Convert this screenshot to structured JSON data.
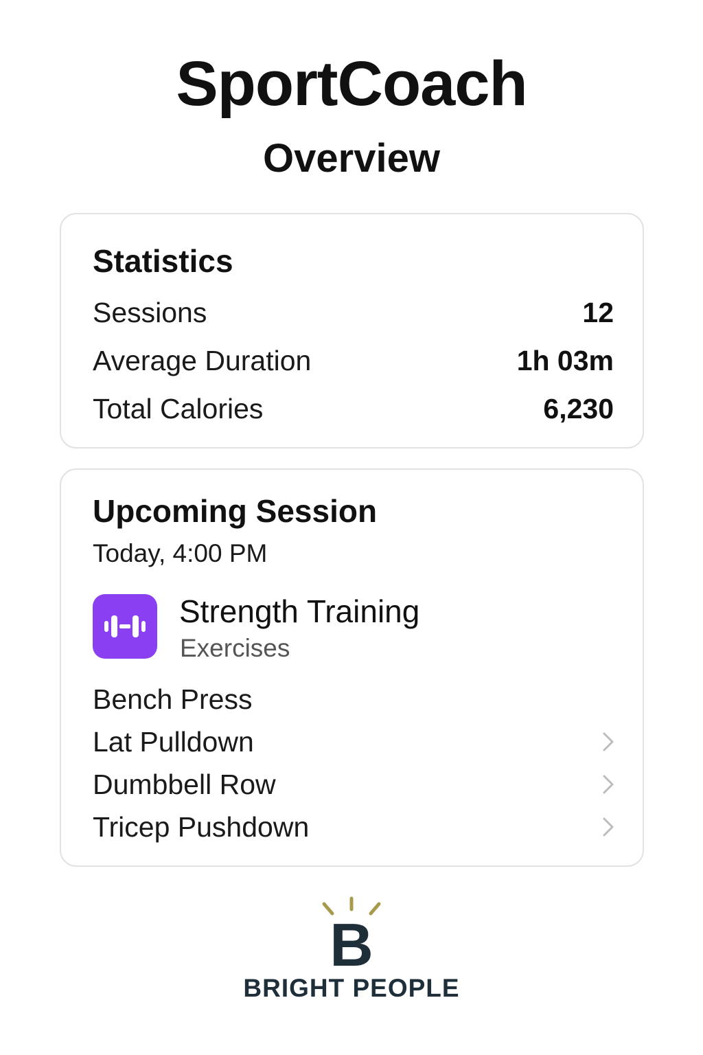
{
  "app": {
    "title": "SportCoach",
    "page_title": "Overview"
  },
  "statistics": {
    "title": "Statistics",
    "rows": [
      {
        "label": "Sessions",
        "value": "12"
      },
      {
        "label": "Average Duration",
        "value": "1h 03m"
      },
      {
        "label": "Total Calories",
        "value": "6,230"
      }
    ]
  },
  "upcoming": {
    "title": "Upcoming Session",
    "time": "Today, 4:00 PM",
    "workout": {
      "name": "Strength Training",
      "subtitle": "Exercises",
      "icon": "dumbbell-icon",
      "icon_color": "#8a3ff0"
    },
    "exercises": [
      {
        "label": "Bench Press",
        "chevron": false
      },
      {
        "label": "Lat Pulldown",
        "chevron": true
      },
      {
        "label": "Dumbbell Row",
        "chevron": true
      },
      {
        "label": "Tricep Pushdown",
        "chevron": true
      }
    ]
  },
  "brand": {
    "name": "BRIGHT PEOPLE",
    "logo_letter": "B",
    "accent_color": "#a89a4c",
    "logo_color": "#1f2f3a"
  }
}
